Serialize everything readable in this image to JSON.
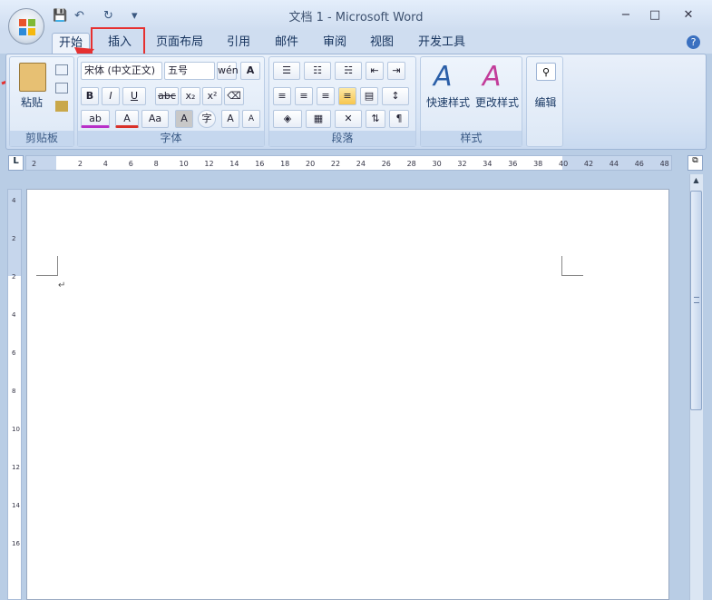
{
  "window": {
    "title": "文档 1 - Microsoft Word",
    "minimize": "−",
    "maximize": "□",
    "close": "✕"
  },
  "qat": {
    "save": "💾",
    "undo": "↶",
    "redo": "↻",
    "customize": "▾"
  },
  "tabs": [
    "开始",
    "插入",
    "页面布局",
    "引用",
    "邮件",
    "审阅",
    "视图",
    "开发工具"
  ],
  "help": "?",
  "groups": {
    "clipboard": {
      "label": "剪贴板",
      "paste": "粘贴"
    },
    "font": {
      "label": "字体",
      "font_name": "宋体 (中文正文)",
      "font_size": "五号",
      "wen": "wén",
      "bold": "B",
      "italic": "I",
      "underline": "U",
      "strike": "abc",
      "sub": "x₂",
      "sup": "x²",
      "highlight": "ab",
      "fontcolor": "A",
      "case": "Aa",
      "shade": "A",
      "enclose": "字",
      "grow": "A",
      "shrink": "A"
    },
    "paragraph": {
      "label": "段落"
    },
    "styles": {
      "label": "样式",
      "quick": "快速样式",
      "change": "更改样式"
    },
    "editing": {
      "label": "编辑"
    }
  },
  "ruler_ticks": [
    "2",
    "2",
    "4",
    "6",
    "8",
    "10",
    "12",
    "14",
    "16",
    "18",
    "20",
    "22",
    "24",
    "26",
    "28",
    "30",
    "32",
    "34",
    "36",
    "38",
    "40",
    "42",
    "44",
    "46",
    "48"
  ],
  "vruler_ticks": [
    "4",
    "2",
    "2",
    "4",
    "6",
    "8",
    "10",
    "12",
    "14",
    "16"
  ],
  "paragraph_mark": "↵",
  "annotation_color": "#e63030"
}
